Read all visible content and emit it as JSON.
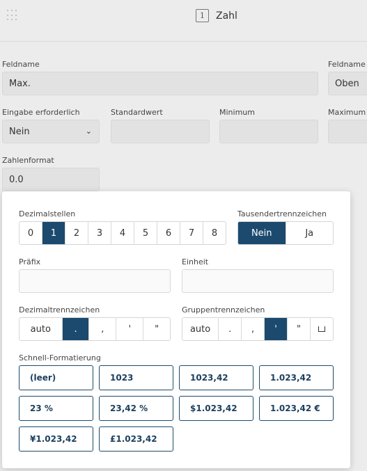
{
  "header": {
    "title": "Zahl",
    "type_icon_text": "1"
  },
  "form": {
    "fieldname_label": "Feldname",
    "fieldname_value": "Max.",
    "fieldname2_label": "Feldname (",
    "fieldname2_value": "Oben",
    "required_label": "Eingabe erforderlich",
    "required_value": "Nein",
    "default_label": "Standardwert",
    "min_label": "Minimum",
    "max_label": "Maximum",
    "numformat_label": "Zahlenformat",
    "numformat_value": "0.0"
  },
  "popover": {
    "decimals_label": "Dezimalstellen",
    "decimals": [
      "0",
      "1",
      "2",
      "3",
      "4",
      "5",
      "6",
      "7",
      "8"
    ],
    "decimals_selected": 1,
    "thousands_label": "Tausendertrennzeichen",
    "thousands": [
      "Nein",
      "Ja"
    ],
    "thousands_selected": 0,
    "prefix_label": "Präfix",
    "unit_label": "Einheit",
    "decsep_label": "Dezimaltrennzeichen",
    "decsep": [
      "auto",
      ".",
      ",",
      "'",
      "\""
    ],
    "decsep_selected": 1,
    "groupsep_label": "Gruppentrennzeichen",
    "groupsep": [
      "auto",
      ".",
      ",",
      "'",
      "\""
    ],
    "groupsep_selected": 3,
    "groupsep_space_icon": "space-icon",
    "quick_label": "Schnell-Formatierung",
    "quick": [
      "(leer)",
      "1023",
      "1023,42",
      "1.023,42",
      "23 %",
      "23,42 %",
      "$1.023,42",
      "1.023,42 €",
      "¥1.023,42",
      "£1.023,42"
    ]
  },
  "colors": {
    "accent": "#1b4a6e",
    "background": "#ececec"
  }
}
